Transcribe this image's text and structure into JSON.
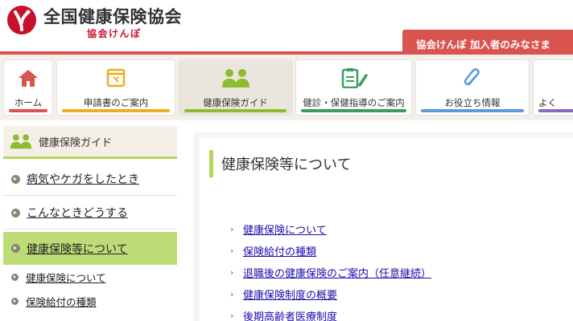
{
  "header": {
    "title": "全国健康保険協会",
    "subtitle": "協会けんぽ",
    "member_tab": "協会けんぽ 加入者のみなさま"
  },
  "gnav": {
    "items": [
      {
        "label": "ホーム",
        "icon": "home-icon",
        "bar_color": "#d9534f"
      },
      {
        "label": "申請書のご案内",
        "icon": "form-window-icon",
        "bar_color": "#f0ad1e"
      },
      {
        "label": "健康保険ガイド",
        "icon": "people-icon",
        "bar_color": "#8cbd2f"
      },
      {
        "label": "健診・保健指導のご案内",
        "icon": "clipboard-pen-icon",
        "bar_color": "#3a9d5d"
      },
      {
        "label": "お役立ち情報",
        "icon": "paperclip-icon",
        "bar_color": "#5b9bd5"
      },
      {
        "label": "よく",
        "icon": "",
        "bar_color": "#8a6bbd"
      }
    ]
  },
  "sidebar": {
    "title": "健康保険ガイド",
    "links": [
      {
        "label": "病気やケガをしたとき"
      },
      {
        "label": "こんなときどうする"
      },
      {
        "label": "健康保険等について"
      }
    ],
    "sublinks": [
      {
        "label": "健康保険について"
      },
      {
        "label": "保険給付の種類"
      }
    ]
  },
  "main": {
    "title": "健康保険等について",
    "links": [
      {
        "label": "健康保険について"
      },
      {
        "label": "保険給付の種類"
      },
      {
        "label": "退職後の健康保険のご案内（任意継続）"
      },
      {
        "label": "健康保険制度の概要"
      },
      {
        "label": "後期高齢者医療制度"
      }
    ]
  },
  "colors": {
    "brand_red": "#d9534f",
    "guide_green": "#b5d45a"
  }
}
